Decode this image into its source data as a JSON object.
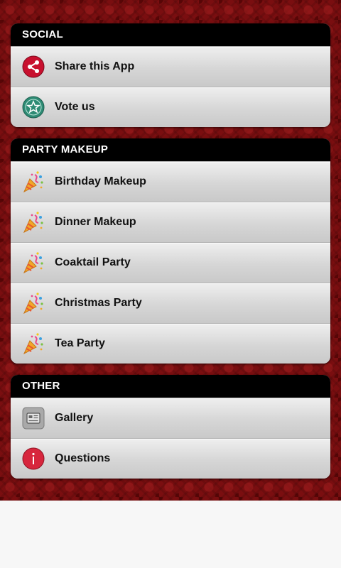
{
  "sections": [
    {
      "header": "SOCIAL",
      "items": [
        {
          "label": "Share this App",
          "icon": "share-icon"
        },
        {
          "label": "Vote us",
          "icon": "star-icon"
        }
      ]
    },
    {
      "header": "PARTY MAKEUP",
      "items": [
        {
          "label": "Birthday Makeup",
          "icon": "party-popper-icon"
        },
        {
          "label": "Dinner Makeup",
          "icon": "party-popper-icon"
        },
        {
          "label": "Coaktail Party",
          "icon": "party-popper-icon"
        },
        {
          "label": "Christmas Party",
          "icon": "party-popper-icon"
        },
        {
          "label": "Tea Party",
          "icon": "party-popper-icon"
        }
      ]
    },
    {
      "header": "OTHER",
      "items": [
        {
          "label": "Gallery",
          "icon": "gallery-icon"
        },
        {
          "label": "Questions",
          "icon": "info-icon"
        }
      ]
    }
  ],
  "colors": {
    "background": "#7a0e10",
    "header": "#000000",
    "share_icon": "#c8102e",
    "vote_icon": "#2e8b74",
    "info_icon": "#d7263d"
  }
}
